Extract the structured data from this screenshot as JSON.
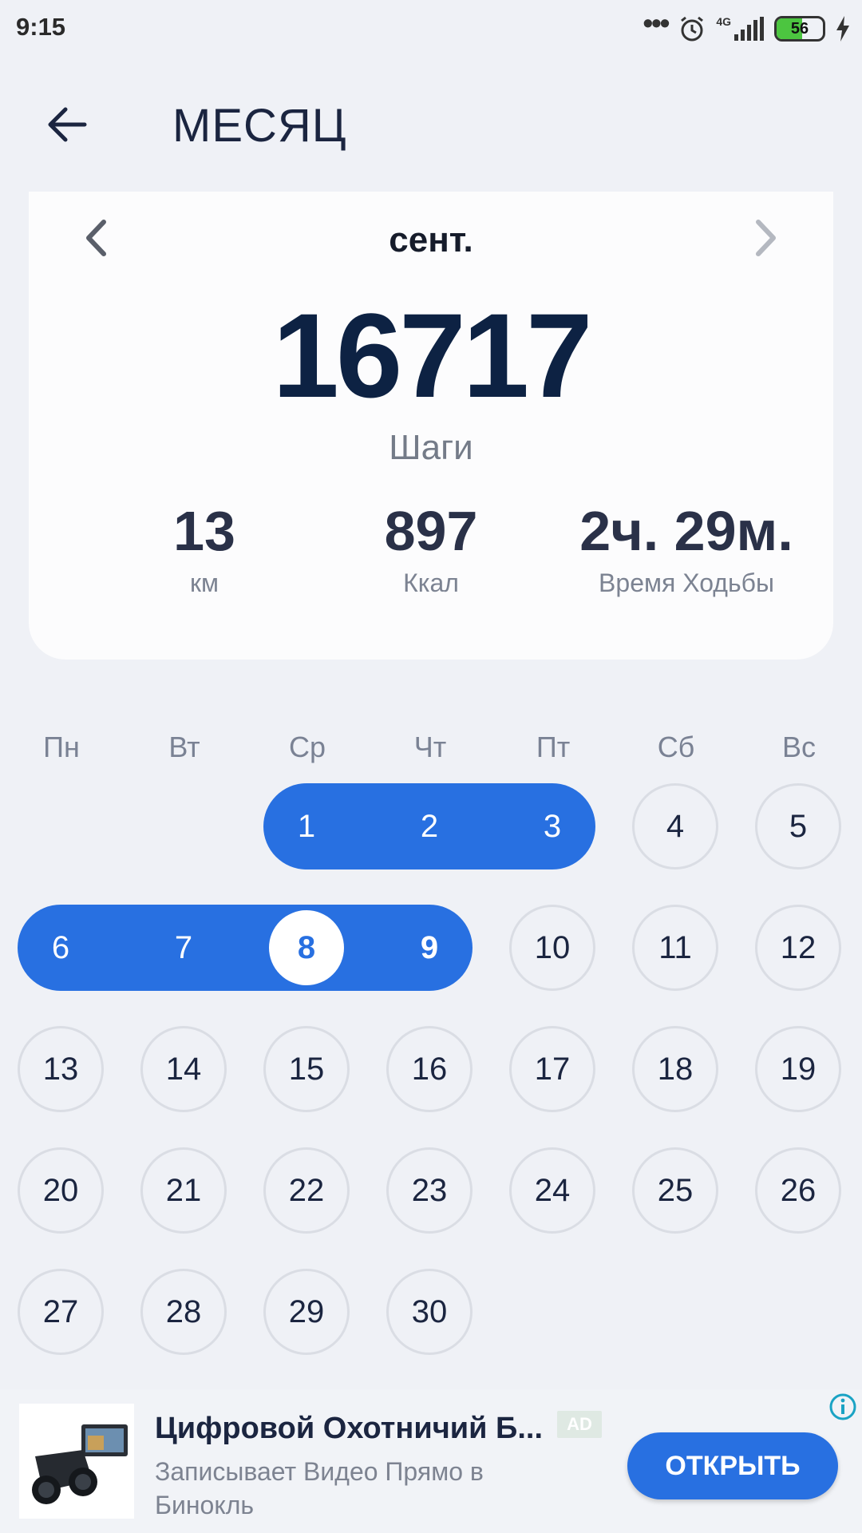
{
  "status_bar": {
    "time": "9:15",
    "network": "4G",
    "battery_level": "56",
    "icons": [
      "more-dots-icon",
      "alarm-icon",
      "signal-icon",
      "battery-icon",
      "charging-icon"
    ]
  },
  "header": {
    "title": "МЕСЯЦ",
    "back_icon": "arrow-left-icon"
  },
  "summary": {
    "month": "сент.",
    "steps": "16717",
    "steps_label": "Шаги",
    "stats": [
      {
        "value": "13",
        "label": "км"
      },
      {
        "value": "897",
        "label": "Ккал"
      },
      {
        "value": "2ч. 29м.",
        "label": "Время Ходьбы"
      }
    ]
  },
  "calendar": {
    "weekdays": [
      "Пн",
      "Вт",
      "Ср",
      "Чт",
      "Пт",
      "Сб",
      "Вс"
    ],
    "days": [
      "1",
      "2",
      "3",
      "4",
      "5",
      "6",
      "7",
      "8",
      "9",
      "10",
      "11",
      "12",
      "13",
      "14",
      "15",
      "16",
      "17",
      "18",
      "19",
      "20",
      "21",
      "22",
      "23",
      "24",
      "25",
      "26",
      "27",
      "28",
      "29",
      "30"
    ],
    "first_weekday_index": 2,
    "active_days": [
      1,
      2,
      3,
      6,
      7,
      8,
      9
    ],
    "today": 8,
    "accent_color": "#2870e1"
  },
  "ad": {
    "title": "Цифровой Охотничий Б...",
    "badge": "AD",
    "description": "Записывает Видео Прямо в Бинокль",
    "cta": "ОТКРЫТЬ",
    "info_icon": "info-icon"
  }
}
